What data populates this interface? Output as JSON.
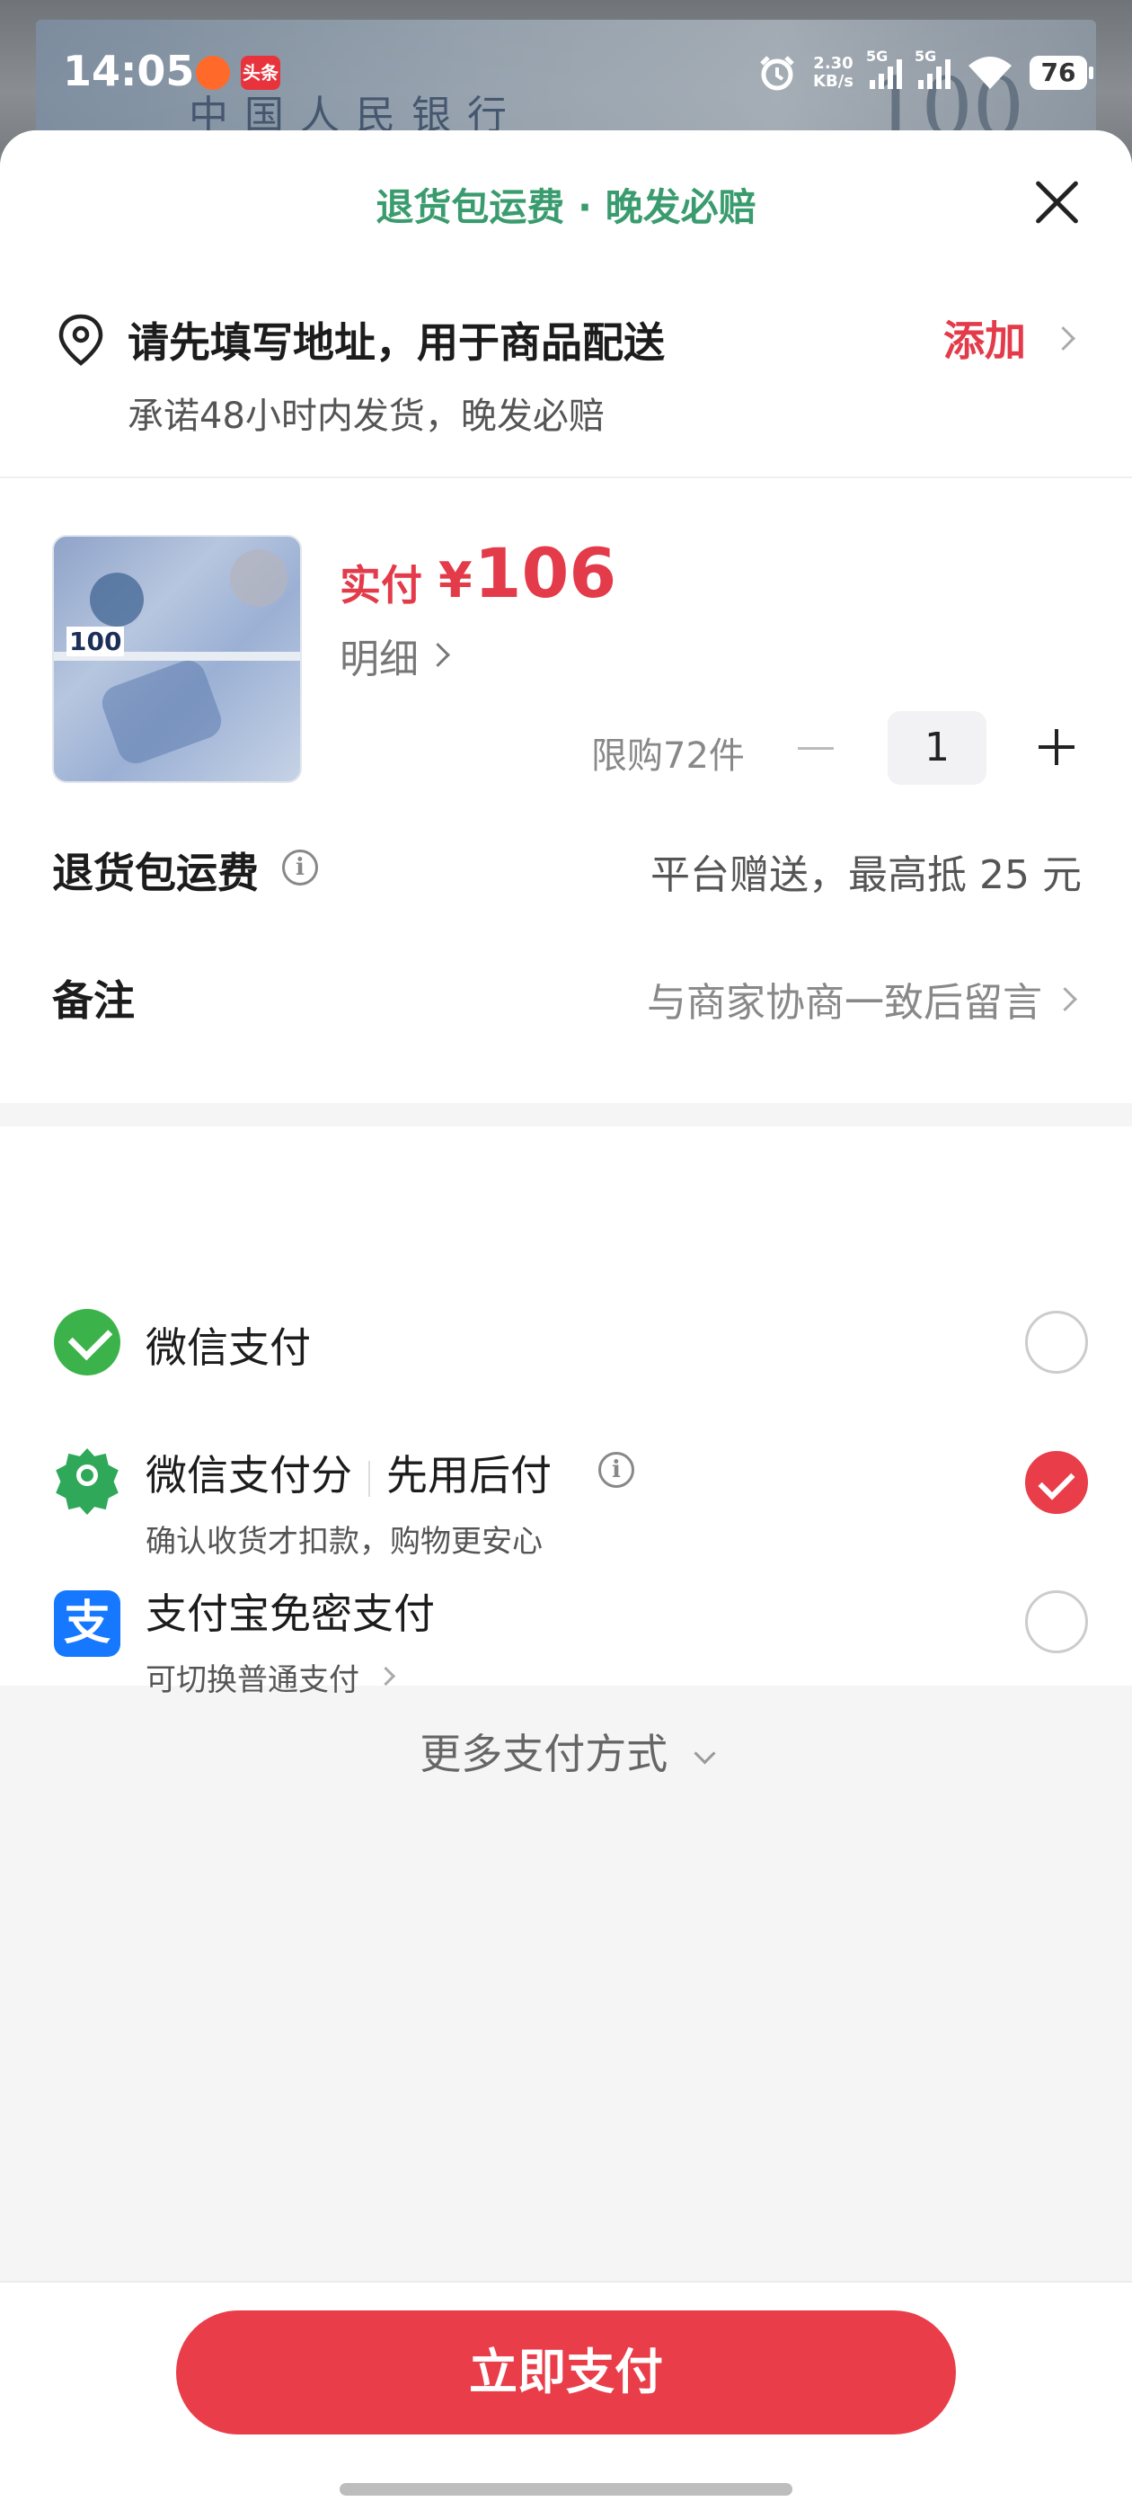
{
  "status_bar": {
    "time": "14:05",
    "app_badge": "头条",
    "speed_value": "2.30",
    "speed_unit": "KB/s",
    "sim1": "5G",
    "sim2": "5G",
    "battery": "76"
  },
  "background": {
    "banknote_text": "中国人民银行",
    "banknote_value": "100"
  },
  "sheet": {
    "header_title": "退货包运费 · 晚发必赔"
  },
  "address": {
    "main": "请先填写地址，用于商品配送",
    "sub": "承诺48小时内发货，晚发必赔",
    "add_label": "添加"
  },
  "product": {
    "image_tag": "100",
    "paid_label": "实付",
    "currency": "¥",
    "paid_amount": "106",
    "detail_label": "明细",
    "limit_text": "限购72件",
    "quantity": "1"
  },
  "rows": {
    "shipping_label": "退货包运费",
    "shipping_value": "平台赠送，最高抵 25 元",
    "remark_label": "备注",
    "remark_value": "与商家协商一致后留言"
  },
  "payment": {
    "methods": [
      {
        "name": "微信支付",
        "selected": false,
        "icon": "wechat-pay-icon"
      },
      {
        "name": "微信支付分",
        "name_extra": "先用后付",
        "sub": "确认收货才扣款，购物更安心",
        "selected": true,
        "icon": "wechat-score-icon"
      },
      {
        "name": "支付宝免密支付",
        "sub": "可切换普通支付",
        "selected": false,
        "icon": "alipay-icon"
      }
    ],
    "more_label": "更多支付方式"
  },
  "footer": {
    "pay_button": "立即支付"
  },
  "colors": {
    "accent_red": "#e93e4a",
    "header_green": "#3a9c6e",
    "wechat_green": "#3cb34a",
    "alipay_blue": "#1677ff"
  }
}
